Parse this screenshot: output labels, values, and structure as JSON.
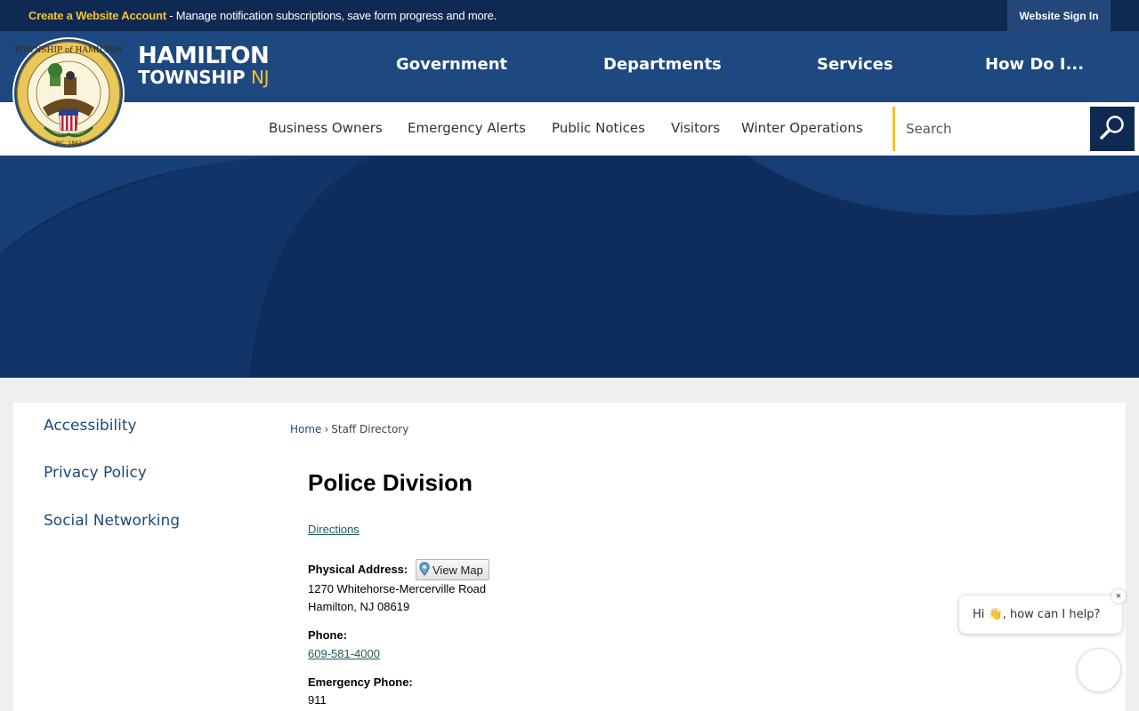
{
  "topbar": {
    "create_account_label": "Create a Website Account",
    "message": " - Manage notification subscriptions, save form progress and more.",
    "sign_in_label": "Website Sign In"
  },
  "brand": {
    "line1": "HAMILTON",
    "line2_a": "TOWNSHIP",
    "line2_b": "NJ",
    "seal_icon": "township-seal-icon"
  },
  "main_nav": {
    "items": [
      {
        "label": "Government"
      },
      {
        "label": "Departments"
      },
      {
        "label": "Services"
      },
      {
        "label": "How Do I..."
      }
    ]
  },
  "sub_nav": {
    "items": [
      {
        "label": "Business Owners"
      },
      {
        "label": "Emergency Alerts"
      },
      {
        "label": "Public Notices"
      },
      {
        "label": "Visitors"
      },
      {
        "label": "Winter Operations"
      }
    ]
  },
  "search": {
    "placeholder": "Search",
    "button_icon": "search-icon"
  },
  "side_nav": {
    "items": [
      {
        "label": "Accessibility"
      },
      {
        "label": "Privacy Policy"
      },
      {
        "label": "Social Networking"
      }
    ]
  },
  "breadcrumb": {
    "home": "Home",
    "separator": "›",
    "current": "Staff Directory"
  },
  "main": {
    "title": "Police Division",
    "directions_label": "Directions",
    "physical_address_label": "Physical Address:",
    "view_map_label": "View Map",
    "address_line1": "1270 Whitehorse-Mercerville Road",
    "address_line2": "Hamilton, NJ 08619",
    "phone_label": "Phone:",
    "phone_value": "609-581-4000",
    "emergency_phone_label": "Emergency Phone:",
    "emergency_phone_value": "911"
  },
  "chat": {
    "greeting": "Hi 👋, how can I help?",
    "close_label": "×"
  },
  "colors": {
    "topbar": "#0f2a52",
    "header": "#1d4880",
    "accent": "#f2c230",
    "hero": "#0f2d5c",
    "link": "#1d4880"
  }
}
